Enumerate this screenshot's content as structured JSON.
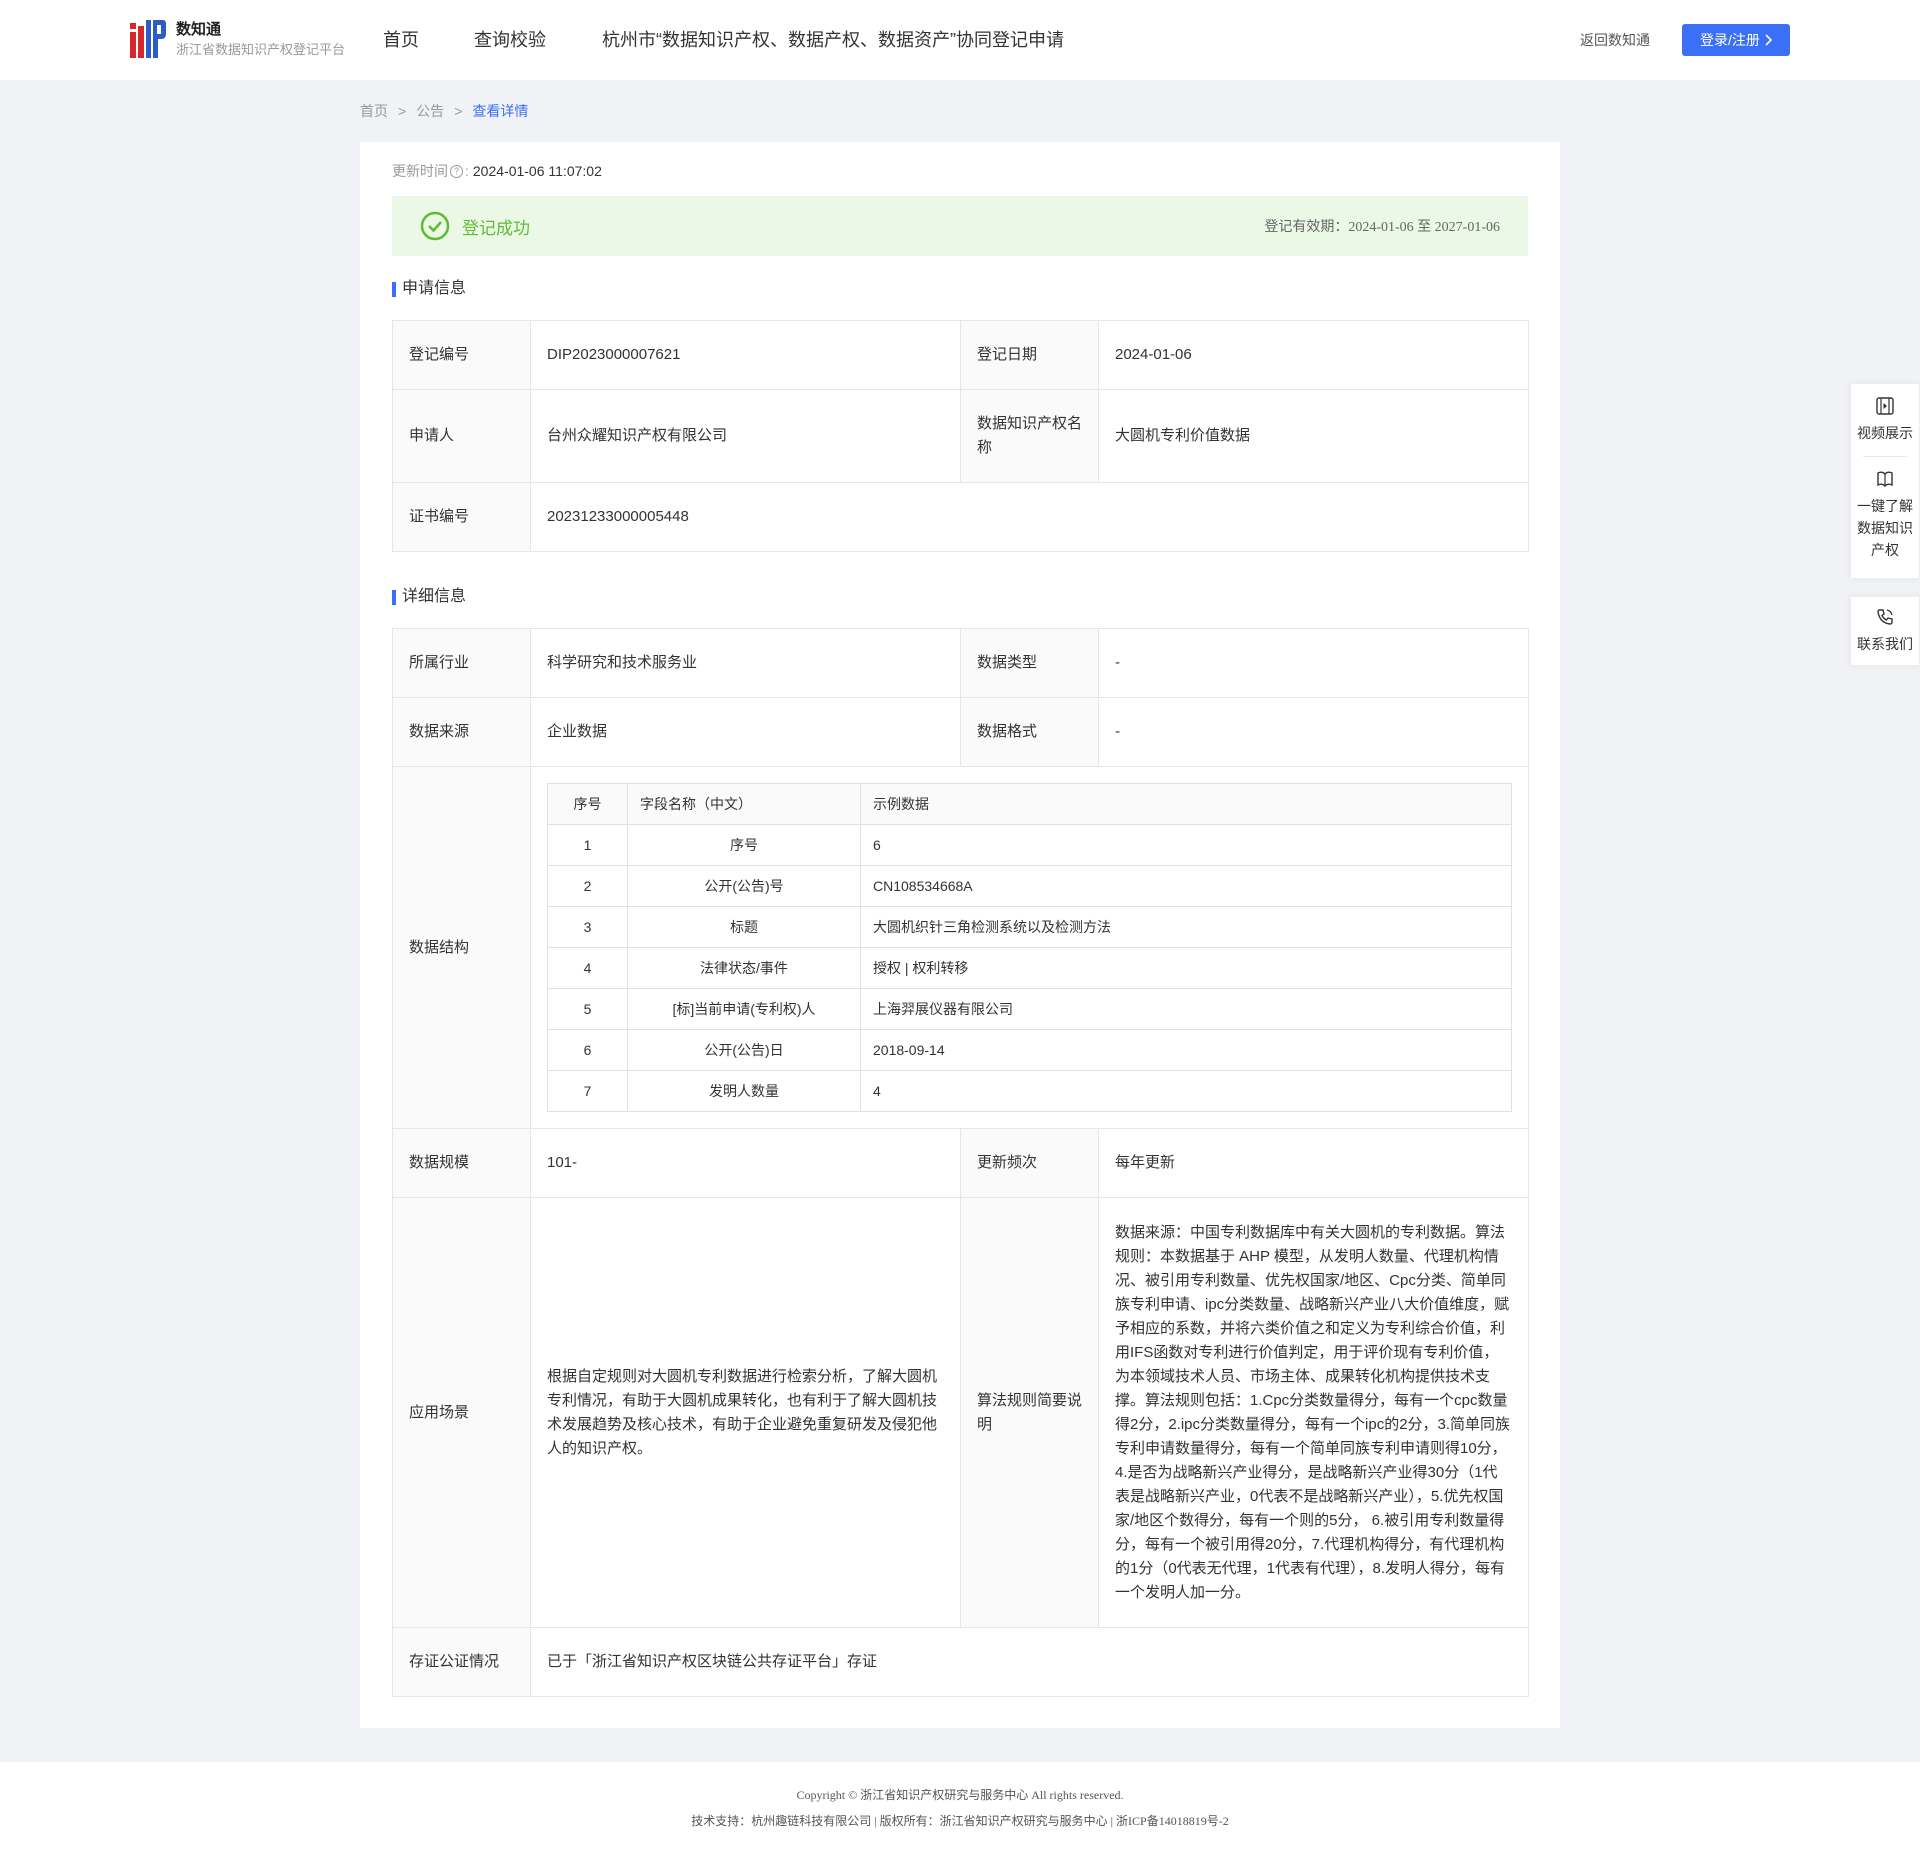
{
  "header": {
    "brand_name": "数知通",
    "brand_subtitle": "浙江省数据知识产权登记平台",
    "nav": [
      "首页",
      "查询校验",
      "杭州市“数据知识产权、数据产权、数据资产”协同登记申请"
    ],
    "back_link": "返回数知通",
    "login_button": "登录/注册"
  },
  "breadcrumb": {
    "items": [
      "首页",
      "公告"
    ],
    "separator": ">",
    "current": "查看详情"
  },
  "updated": {
    "label": "更新时间",
    "colon": ":",
    "value": "2024-01-06 11:07:02"
  },
  "status": {
    "text": "登记成功",
    "period": "登记有效期：2024-01-06 至 2027-01-06",
    "color": "#5fbb36"
  },
  "application": {
    "title": "申请信息",
    "reg_no_label": "登记编号",
    "reg_no": "DIP2023000007621",
    "reg_date_label": "登记日期",
    "reg_date": "2024-01-06",
    "applicant_label": "申请人",
    "applicant": "台州众耀知识产权有限公司",
    "ip_name_label": "数据知识产权名称",
    "ip_name": "大圆机专利价值数据",
    "cert_no_label": "证书编号",
    "cert_no": "20231233000005448"
  },
  "detail": {
    "title": "详细信息",
    "industry_label": "所属行业",
    "industry": "科学研究和技术服务业",
    "data_type_label": "数据类型",
    "data_type": "-",
    "source_label": "数据来源",
    "source": "企业数据",
    "format_label": "数据格式",
    "format": "-",
    "structure_label": "数据结构",
    "structure_headers": [
      "序号",
      "字段名称（中文）",
      "示例数据"
    ],
    "structure_rows": [
      [
        "1",
        "序号",
        "6"
      ],
      [
        "2",
        "公开(公告)号",
        "CN108534668A"
      ],
      [
        "3",
        "标题",
        "大圆机织针三角检测系统以及检测方法"
      ],
      [
        "4",
        "法律状态/事件",
        "授权 | 权利转移"
      ],
      [
        "5",
        "[标]当前申请(专利权)人",
        "上海羿展仪器有限公司"
      ],
      [
        "6",
        "公开(公告)日",
        "2018-09-14"
      ],
      [
        "7",
        "发明人数量",
        "4"
      ]
    ],
    "scale_label": "数据规模",
    "scale": "101-",
    "frequency_label": "更新频次",
    "frequency": "每年更新",
    "scenario_label": "应用场景",
    "scenario": "根据自定规则对大圆机专利数据进行检索分析，了解大圆机专利情况，有助于大圆机成果转化，也有利于了解大圆机技术发展趋势及核心技术，有助于企业避免重复研发及侵犯他人的知识产权。",
    "algorithm_label": "算法规则简要说明",
    "algorithm": "数据来源：中国专利数据库中有关大圆机的专利数据。算法规则：本数据基于 AHP 模型，从发明人数量、代理机构情况、被引用专利数量、优先权国家/地区、Cpc分类、简单同族专利申请、ipc分类数量、战略新兴产业八大价值维度，赋予相应的系数，并将六类价值之和定义为专利综合价值，利用IFS函数对专利进行价值判定，用于评价现有专利价值，为本领域技术人员、市场主体、成果转化机构提供技术支撑。算法规则包括：1.Cpc分类数量得分，每有一个cpc数量得2分，2.ipc分类数量得分，每有一个ipc的2分，3.简单同族专利申请数量得分，每有一个简单同族专利申请则得10分，4.是否为战略新兴产业得分，是战略新兴产业得30分（1代表是战略新兴产业，0代表不是战略新兴产业），5.优先权国家/地区个数得分，每有一个则的5分， 6.被引用专利数量得分，每有一个被引用得20分，7.代理机构得分，有代理机构的1分（0代表无代理，1代表有代理），8.发明人得分，每有一个发明人加一分。",
    "notary_label": "存证公证情况",
    "notary": "已于「浙江省知识产权区块链公共存证平台」存证"
  },
  "sidebar": {
    "video": "视频展示",
    "learn": "一键了解数据知识产权",
    "contact": "联系我们"
  },
  "footer": {
    "copyright": "Copyright © 浙江省知识产权研究与服务中心 All rights reserved.",
    "support": "技术支持：杭州趣链科技有限公司 | 版权所有：浙江省知识产权研究与服务中心 | 浙ICP备14018819号-2"
  },
  "colors": {
    "accent": "#3b6ff5",
    "success": "#5fbb36",
    "success_bg": "#ecf8e6",
    "page_bg": "#f0f2f5"
  }
}
